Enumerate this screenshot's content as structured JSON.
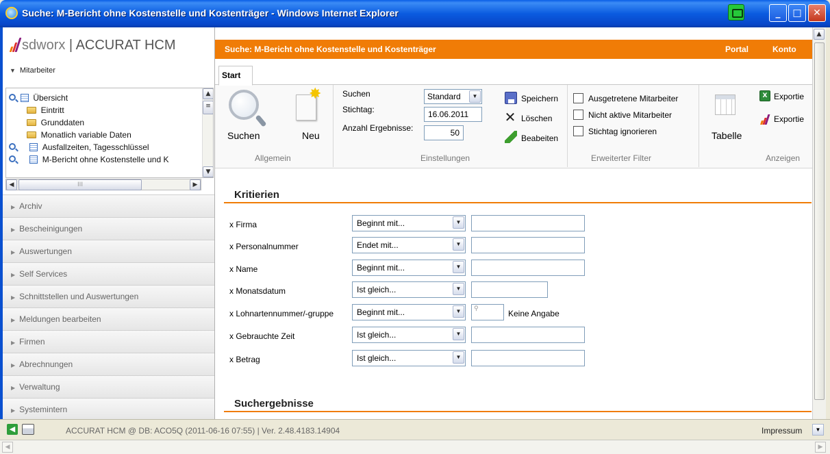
{
  "window": {
    "title": "Suche: M-Bericht ohne Kostenstelle und Kostenträger - Windows Internet Explorer",
    "buttons": {
      "minimize": "_",
      "maximize": "□",
      "close": "✕"
    }
  },
  "brand": {
    "logo_name": "sdworx",
    "separator": "|",
    "product": "ACCURAT HCM",
    "colors": [
      "#f07c06",
      "#e0302c",
      "#8a1c7c"
    ]
  },
  "sidebar": {
    "section_title": "Mitarbeiter",
    "tree": [
      {
        "label": "Übersicht",
        "icon": "doc-icon",
        "search": true
      },
      {
        "label": "Eintritt",
        "icon": "folder-icon",
        "search": false
      },
      {
        "label": "Grunddaten",
        "icon": "folder-icon",
        "search": false
      },
      {
        "label": "Monatlich variable Daten",
        "icon": "folder-open-icon",
        "search": false
      },
      {
        "label": "Ausfallzeiten, Tagesschlüssel",
        "icon": "doc-icon",
        "search": true
      },
      {
        "label": "M-Bericht ohne Kostenstelle und K",
        "icon": "doc-icon",
        "search": true
      }
    ],
    "hscroll_grip": "III",
    "accordion": [
      "Archiv",
      "Bescheinigungen",
      "Auswertungen",
      "Self Services",
      "Schnittstellen und Auswertungen",
      "Meldungen bearbeiten",
      "Firmen",
      "Abrechnungen",
      "Verwaltung",
      "Systemintern"
    ]
  },
  "header": {
    "title": "Suche: M-Bericht ohne Kostenstelle und Kostenträger",
    "portal": "Portal",
    "konto": "Konto"
  },
  "ribbon": {
    "tab": "Start",
    "allgemein": {
      "group": "Allgemein",
      "search": "Suchen",
      "new": "Neu"
    },
    "einstellungen": {
      "group": "Einstellungen",
      "suchen_label": "Suchen",
      "suchen_value": "Standard",
      "stichtag_label": "Stichtag:",
      "stichtag_value": "16.06.2011",
      "anzahl_label": "Anzahl Ergebnisse:",
      "anzahl_value": "50",
      "save": "Speichern",
      "delete": "Löschen",
      "edit": "Beabeiten"
    },
    "filter": {
      "group": "Erweiterter Filter",
      "opt1": "Ausgetretene Mitarbeiter",
      "opt2": "Nicht aktive Mitarbeiter",
      "opt3": "Stichtag ignorieren"
    },
    "anzeigen": {
      "group": "Anzeigen",
      "table": "Tabelle",
      "export1": "Exportie",
      "export2": "Exportie"
    }
  },
  "criteria": {
    "title": "Kritierien",
    "rows": [
      {
        "label": "x Firma",
        "operator": "Beginnt mit..."
      },
      {
        "label": "x Personalnummer",
        "operator": "Endet mit..."
      },
      {
        "label": "x Name",
        "operator": "Beginnt mit..."
      },
      {
        "label": "x Monatsdatum",
        "operator": "Ist gleich..."
      },
      {
        "label": "x Lohnartennummer/-gruppe",
        "operator": "Beginnt mit...",
        "extra": "Keine Angabe"
      },
      {
        "label": "x Gebrauchte Zeit",
        "operator": "Ist gleich..."
      },
      {
        "label": "x Betrag",
        "operator": "Ist gleich..."
      }
    ]
  },
  "results": {
    "title": "Suchergebnisse"
  },
  "statusbar": {
    "text": "ACCURAT HCM @ DB: ACO5Q (2011-06-16 07:55) | Ver. 2.48.4183.14904",
    "impressum": "Impressum"
  }
}
